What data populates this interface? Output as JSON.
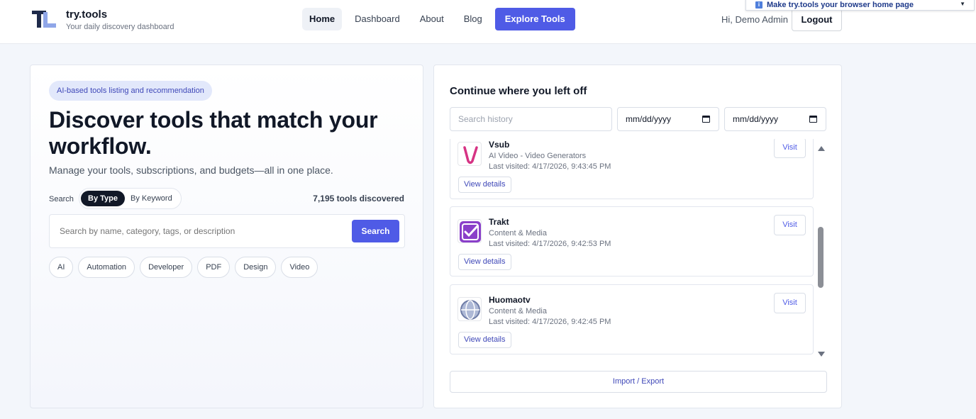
{
  "header": {
    "brand_title": "try.tools",
    "brand_subtitle": "Your daily discovery dashboard",
    "nav": [
      {
        "label": "Home",
        "active": true
      },
      {
        "label": "Dashboard",
        "active": false
      },
      {
        "label": "About",
        "active": false
      },
      {
        "label": "Blog",
        "active": false
      }
    ],
    "explore_label": "Explore Tools",
    "greeting": "Hi, Demo Admin",
    "logout_label": "Logout",
    "banner_text": "Make try.tools your browser home page"
  },
  "hero": {
    "tag": "AI-based tools listing and recommendation",
    "title": "Discover tools that match your workflow.",
    "subtitle": "Manage your tools, subscriptions, and budgets—all in one place.",
    "search_label": "Search",
    "toggle_on": "By Type",
    "toggle_off": "By Keyword",
    "tools_count": "7,195 tools discovered",
    "search_placeholder": "Search by name, category, tags, or description",
    "search_button": "Search",
    "chips": [
      "AI",
      "Automation",
      "Developer",
      "PDF",
      "Design",
      "Video"
    ]
  },
  "history": {
    "title": "Continue where you left off",
    "search_placeholder": "Search history",
    "date_from_placeholder": "mm/dd/yyyy",
    "date_to_placeholder": "mm/dd/yyyy",
    "visit_label": "Visit",
    "details_label": "View details",
    "entries": [
      {
        "name": "Vsub",
        "category": "AI Video - Video Generators",
        "visited": "Last visited: 4/17/2026, 9:43:45 PM",
        "icon": "vsub-logo-icon"
      },
      {
        "name": "Trakt",
        "category": "Content & Media",
        "visited": "Last visited: 4/17/2026, 9:42:53 PM",
        "icon": "trakt-logo-icon"
      },
      {
        "name": "Huomaotv",
        "category": "Content & Media",
        "visited": "Last visited: 4/17/2026, 9:42:45 PM",
        "icon": "globe-icon"
      }
    ],
    "import_export_label": "Import / Export"
  },
  "colors": {
    "accent": "#4f5be6",
    "tag_bg": "#e2e8fb",
    "dark": "#111827"
  }
}
